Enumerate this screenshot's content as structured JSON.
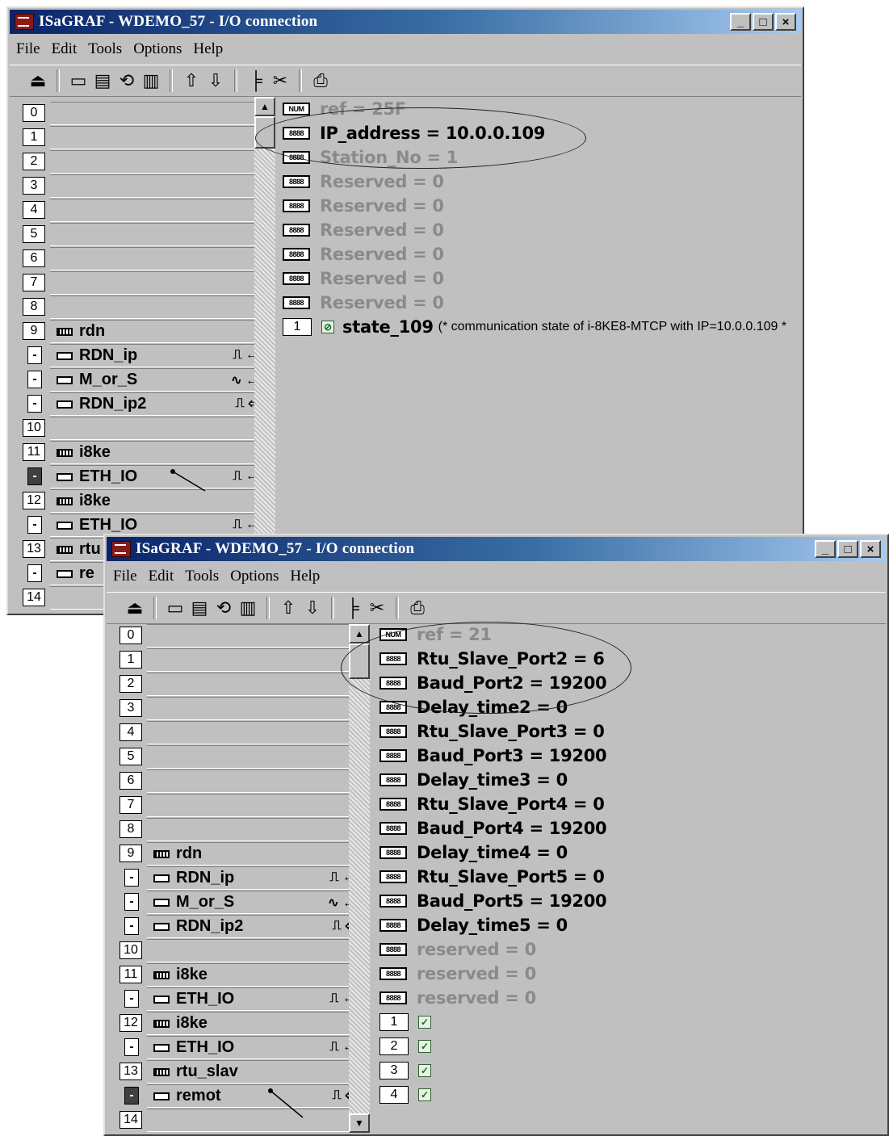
{
  "windows": [
    {
      "title": "ISaGRAF - WDEMO_57 - I/O connection",
      "caption_buttons": [
        "_",
        "□",
        "×"
      ],
      "menu": [
        "File",
        "Edit",
        "Tools",
        "Options",
        "Help"
      ],
      "toolbar_icons": [
        "open-icon",
        "board-icon",
        "save-board-icon",
        "param-icon",
        "delete-icon",
        "arrow-up-icon",
        "arrow-down-icon",
        "connect-icon",
        "cut-icon",
        "print-icon"
      ],
      "slots": [
        {
          "num": "0"
        },
        {
          "num": "1"
        },
        {
          "num": "2"
        },
        {
          "num": "3"
        },
        {
          "num": "4"
        },
        {
          "num": "5"
        },
        {
          "num": "6"
        },
        {
          "num": "7"
        },
        {
          "num": "8"
        },
        {
          "num": "9",
          "label": "rdn"
        },
        {
          "sub": "-",
          "label": "RDN_ip",
          "sig": "⎍ ←"
        },
        {
          "sub": "-",
          "label": "M_or_S",
          "sig": "∿ ←"
        },
        {
          "sub": "-",
          "label": "RDN_ip2",
          "sig": "⎍ ⇦"
        },
        {
          "num": "10"
        },
        {
          "num": "11",
          "label": "i8ke"
        },
        {
          "sub": "-",
          "label": "ETH_IO",
          "sig": "⎍ ←",
          "dark": true
        },
        {
          "num": "12",
          "label": "i8ke"
        },
        {
          "sub": "-",
          "label": "ETH_IO",
          "sig": "⎍ ←"
        },
        {
          "num": "13",
          "label": "rtu"
        },
        {
          "sub": "-",
          "label": "re"
        },
        {
          "num": "14"
        }
      ],
      "params": [
        {
          "chip": "NUM",
          "text": "ref = 25F",
          "grey": true
        },
        {
          "chip": "8888",
          "text": "IP_address = 10.0.0.109"
        },
        {
          "chip": "8888",
          "text": "Station_No = 1",
          "grey": true
        },
        {
          "chip": "8888",
          "text": "Reserved = 0",
          "grey": true
        },
        {
          "chip": "8888",
          "text": "Reserved = 0",
          "grey": true
        },
        {
          "chip": "8888",
          "text": "Reserved = 0",
          "grey": true
        },
        {
          "chip": "8888",
          "text": "Reserved = 0",
          "grey": true
        },
        {
          "chip": "8888",
          "text": "Reserved = 0",
          "grey": true
        },
        {
          "chip": "8888",
          "text": "Reserved = 0",
          "grey": true
        }
      ],
      "channel": {
        "num": "1",
        "name": "state_109",
        "comment": "(* communication state of i-8KE8-MTCP with IP=10.0.0.109 *"
      }
    },
    {
      "title": "ISaGRAF - WDEMO_57 - I/O connection",
      "caption_buttons": [
        "_",
        "□",
        "×"
      ],
      "menu": [
        "File",
        "Edit",
        "Tools",
        "Options",
        "Help"
      ],
      "slots": [
        {
          "num": "0"
        },
        {
          "num": "1"
        },
        {
          "num": "2"
        },
        {
          "num": "3"
        },
        {
          "num": "4"
        },
        {
          "num": "5"
        },
        {
          "num": "6"
        },
        {
          "num": "7"
        },
        {
          "num": "8"
        },
        {
          "num": "9",
          "label": "rdn"
        },
        {
          "sub": "-",
          "label": "RDN_ip",
          "sig": "⎍ ←"
        },
        {
          "sub": "-",
          "label": "M_or_S",
          "sig": "∿ ←"
        },
        {
          "sub": "-",
          "label": "RDN_ip2",
          "sig": "⎍ ⇦"
        },
        {
          "num": "10"
        },
        {
          "num": "11",
          "label": "i8ke"
        },
        {
          "sub": "-",
          "label": "ETH_IO",
          "sig": "⎍ ←"
        },
        {
          "num": "12",
          "label": "i8ke"
        },
        {
          "sub": "-",
          "label": "ETH_IO",
          "sig": "⎍ ←"
        },
        {
          "num": "13",
          "label": "rtu_slav"
        },
        {
          "sub": "-",
          "label": "remot",
          "sig": "⎍ ⇦",
          "dark": true
        },
        {
          "num": "14"
        }
      ],
      "params": [
        {
          "chip": "NUM",
          "text": "ref = 21",
          "grey": true
        },
        {
          "chip": "8888",
          "text": "Rtu_Slave_Port2 = 6"
        },
        {
          "chip": "8888",
          "text": "Baud_Port2 = 19200"
        },
        {
          "chip": "8888",
          "text": "Delay_time2 = 0"
        },
        {
          "chip": "8888",
          "text": "Rtu_Slave_Port3 = 0"
        },
        {
          "chip": "8888",
          "text": "Baud_Port3 = 19200"
        },
        {
          "chip": "8888",
          "text": "Delay_time3 = 0"
        },
        {
          "chip": "8888",
          "text": "Rtu_Slave_Port4 = 0"
        },
        {
          "chip": "8888",
          "text": "Baud_Port4 = 19200"
        },
        {
          "chip": "8888",
          "text": "Delay_time4 = 0"
        },
        {
          "chip": "8888",
          "text": "Rtu_Slave_Port5 = 0"
        },
        {
          "chip": "8888",
          "text": "Baud_Port5 = 19200"
        },
        {
          "chip": "8888",
          "text": "Delay_time5 = 0"
        },
        {
          "chip": "8888",
          "text": "reserved = 0",
          "grey": true
        },
        {
          "chip": "8888",
          "text": "reserved = 0",
          "grey": true
        },
        {
          "chip": "8888",
          "text": "reserved = 0",
          "grey": true
        }
      ],
      "channels": [
        {
          "num": "1"
        },
        {
          "num": "2"
        },
        {
          "num": "3"
        },
        {
          "num": "4"
        }
      ]
    }
  ]
}
